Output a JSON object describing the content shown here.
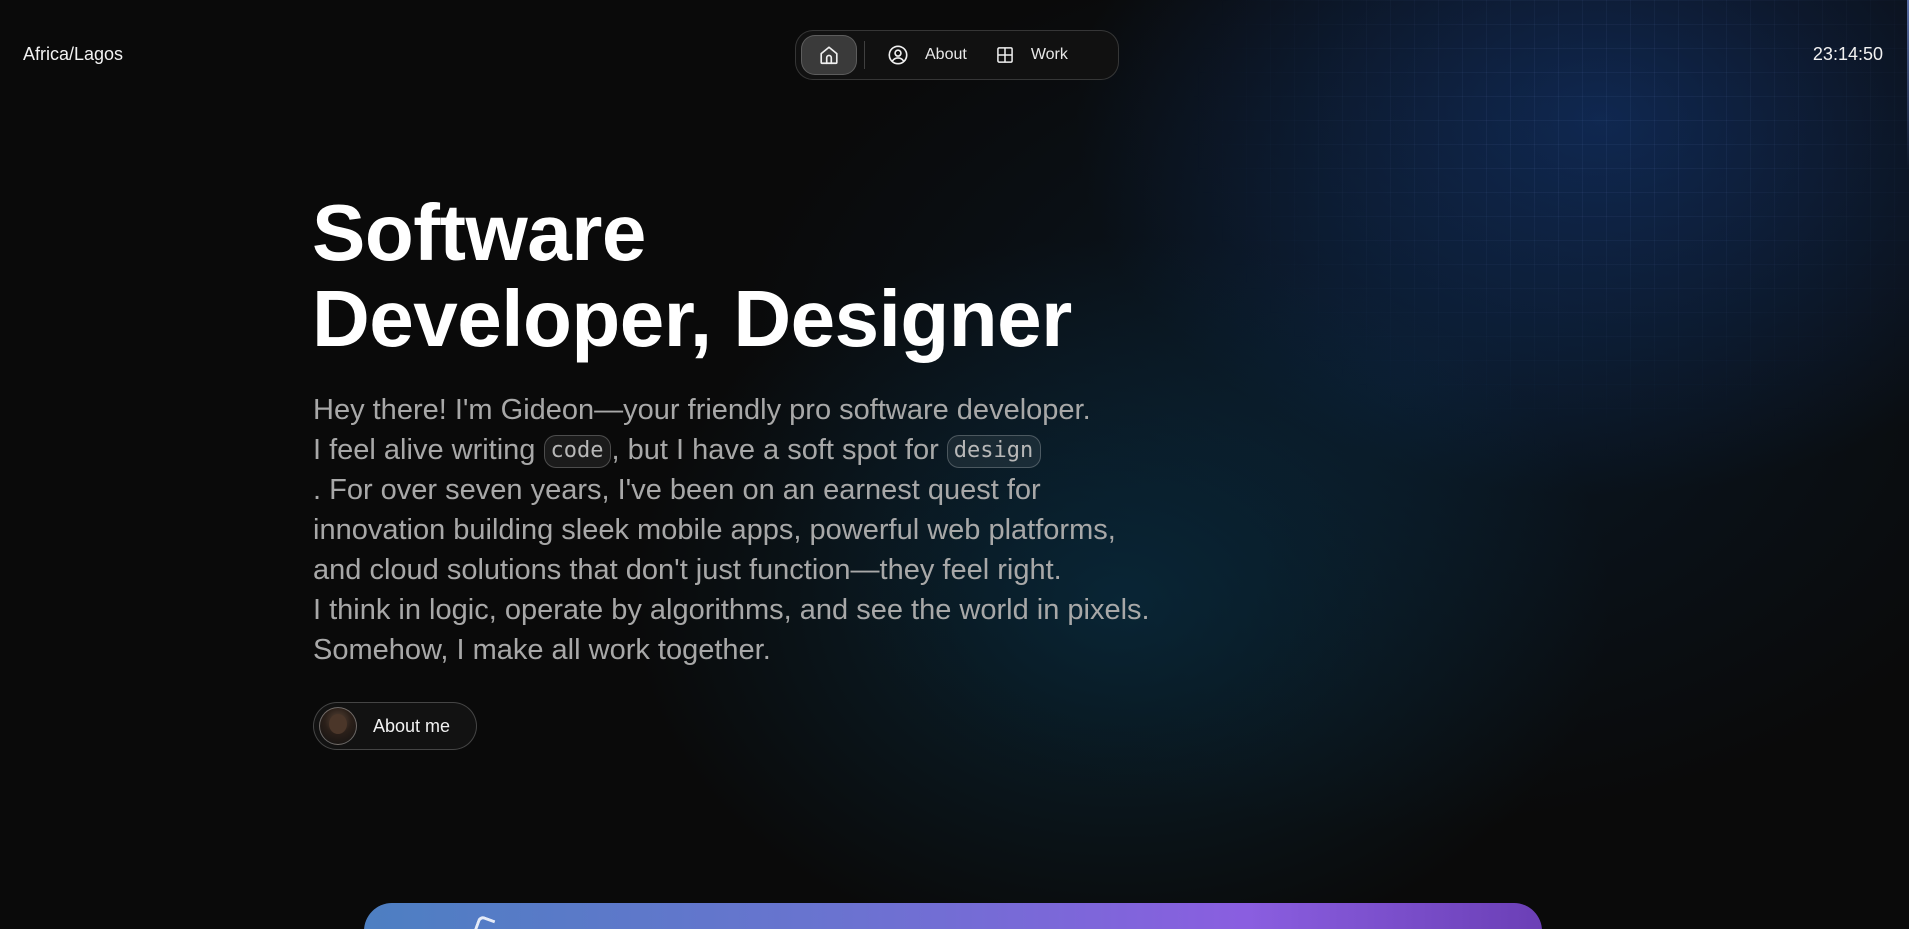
{
  "header": {
    "timezone": "Africa/Lagos",
    "time": "23:14:50"
  },
  "nav": {
    "items": [
      {
        "label": "",
        "icon": "home-icon",
        "active": true
      },
      {
        "label": "About",
        "icon": "user-circle-icon",
        "active": false
      },
      {
        "label": "Work",
        "icon": "grid-icon",
        "active": false
      }
    ]
  },
  "hero": {
    "title_line1": "Software",
    "title_line2": "Developer, Designer",
    "intro": {
      "line1": "Hey there! I'm Gideon—your friendly pro software developer.",
      "line2_before": "I feel alive writing ",
      "code_chip": "code",
      "line2_middle": ", but I have a soft spot for ",
      "design_chip": "design",
      "line3": ". For over seven years, I've been on an earnest quest for",
      "line4": "innovation building sleek mobile apps, powerful web platforms,",
      "line5": "and cloud solutions that don't just function—they feel right.",
      "line6": "I think in logic, operate by algorithms, and see the world in pixels.",
      "line7": "Somehow, I make all work together."
    },
    "about_button_label": "About me"
  },
  "colors": {
    "background": "#0a0a0a",
    "text_primary": "#ffffff",
    "text_muted": "#a8a8a8",
    "card_gradient_start": "#4d7fc2",
    "card_gradient_end": "#8a5ee0"
  }
}
